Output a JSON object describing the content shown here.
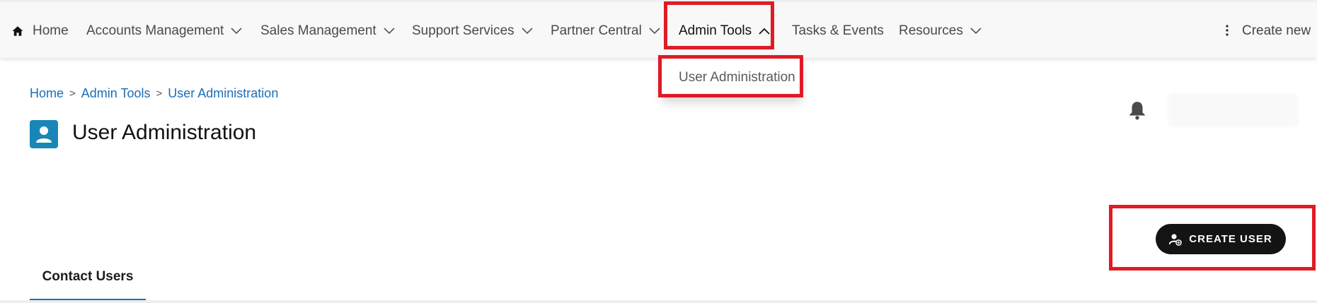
{
  "nav": {
    "items": [
      {
        "label": "Home",
        "icon": "home-icon"
      },
      {
        "label": "Accounts Management",
        "icon": "chevron-down-icon"
      },
      {
        "label": "Sales Management",
        "icon": "chevron-down-icon"
      },
      {
        "label": "Support Services",
        "icon": "chevron-down-icon"
      },
      {
        "label": "Partner Central",
        "icon": "chevron-down-icon"
      },
      {
        "label": "Admin Tools",
        "icon": "chevron-up-icon",
        "active": true
      },
      {
        "label": "Tasks & Events"
      },
      {
        "label": "Resources",
        "icon": "chevron-down-icon"
      }
    ],
    "create_new": "Create new"
  },
  "dropdown": {
    "items": [
      {
        "label": "User Administration"
      }
    ]
  },
  "breadcrumb": {
    "items": [
      "Home",
      "Admin Tools",
      "User Administration"
    ],
    "separator": ">"
  },
  "page": {
    "title": "User Administration",
    "icon": "user-icon"
  },
  "actions": {
    "create_user": "CREATE USER",
    "create_user_icon": "user-add-icon"
  },
  "tabs": [
    {
      "label": "Contact Users",
      "active": true
    }
  ],
  "colors": {
    "accent": "#1a6fb8",
    "highlight": "#e01b24",
    "button": "#141414",
    "title_icon_bg": "#1a86b8"
  }
}
